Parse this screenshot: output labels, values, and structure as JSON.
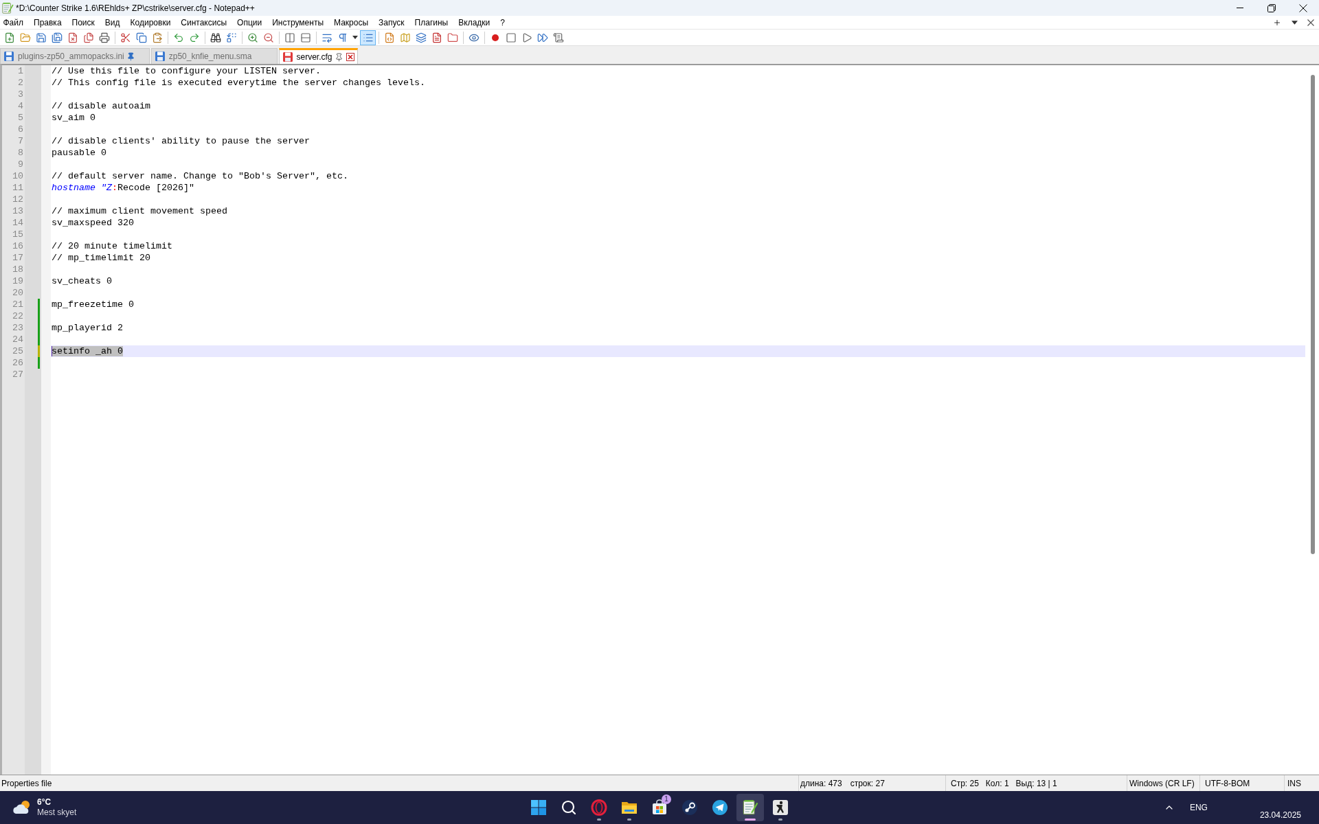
{
  "window": {
    "title": "*D:\\Counter Strike 1.6\\REhlds+ ZP\\cstrike\\server.cfg - Notepad++"
  },
  "menu": [
    "Файл",
    "Правка",
    "Поиск",
    "Вид",
    "Кодировки",
    "Синтаксисы",
    "Опции",
    "Инструменты",
    "Макросы",
    "Запуск",
    "Плагины",
    "Вкладки",
    "?"
  ],
  "toolbar": {
    "buttons": [
      {
        "on": false
      },
      {
        "on": false
      },
      {
        "on": false
      },
      {
        "on": false
      },
      {
        "on": false
      },
      {
        "on": false
      },
      {
        "on": false
      },
      {
        "on": false
      },
      {
        "on": false
      },
      {
        "on": false
      },
      {
        "on": false
      },
      {
        "on": false
      },
      {
        "on": false
      },
      {
        "on": false
      },
      {
        "on": false
      },
      {
        "on": false
      },
      {
        "on": false
      },
      {
        "on": false
      },
      {
        "on": false
      },
      {
        "on": false
      },
      {
        "on": false
      },
      {
        "on": true
      },
      {
        "on": false
      },
      {
        "on": false
      },
      {
        "on": false
      },
      {
        "on": false
      },
      {
        "on": false
      },
      {
        "on": false
      },
      {
        "on": false
      },
      {
        "on": false
      },
      {
        "on": false
      },
      {
        "on": false
      },
      {
        "on": false
      }
    ]
  },
  "tabs": [
    {
      "label": "plugins-zp50_ammopacks.ini",
      "selected": false,
      "modified": false,
      "pinned": true
    },
    {
      "label": "zp50_knfie_menu.sma",
      "selected": false,
      "modified": false,
      "pinned": false
    },
    {
      "label": "server.cfg",
      "selected": true,
      "modified": true,
      "pinned": false
    }
  ],
  "editor": {
    "lines": [
      {
        "number": "1",
        "tokens": [
          {
            "text": "// Use this file to configure your LISTEN server.",
            "kind": "default"
          }
        ],
        "modified": false,
        "current": false
      },
      {
        "number": "2",
        "tokens": [
          {
            "text": "// This config file is executed everytime the server changes levels.",
            "kind": "default"
          }
        ],
        "modified": false,
        "current": false
      },
      {
        "number": "3",
        "modified": false,
        "current": false
      },
      {
        "number": "4",
        "tokens": [
          {
            "text": "// disable autoaim",
            "kind": "default"
          }
        ],
        "modified": false,
        "current": false
      },
      {
        "number": "5",
        "tokens": [
          {
            "text": "sv_aim 0",
            "kind": "default"
          }
        ],
        "modified": false,
        "current": false
      },
      {
        "number": "6",
        "modified": false,
        "current": false
      },
      {
        "number": "7",
        "tokens": [
          {
            "text": "// disable clients' ability to pause the server",
            "kind": "default"
          }
        ],
        "modified": false,
        "current": false
      },
      {
        "number": "8",
        "tokens": [
          {
            "text": "pausable 0",
            "kind": "default"
          }
        ],
        "modified": false,
        "current": false
      },
      {
        "number": "9",
        "modified": false,
        "current": false
      },
      {
        "number": "10",
        "tokens": [
          {
            "text": "// default server name. Change to \"Bob's Server\", etc.",
            "kind": "default"
          }
        ],
        "modified": false,
        "current": false
      },
      {
        "number": "11",
        "tokens": [
          {
            "text": "hostname \"Z",
            "kind": "key"
          },
          {
            "text": ":",
            "kind": "separator"
          },
          {
            "text": "Recode [2026]\"",
            "kind": "default"
          }
        ],
        "modified": false,
        "current": false
      },
      {
        "number": "12",
        "modified": false,
        "current": false
      },
      {
        "number": "13",
        "tokens": [
          {
            "text": "// maximum client movement speed",
            "kind": "default"
          }
        ],
        "modified": false,
        "current": false
      },
      {
        "number": "14",
        "tokens": [
          {
            "text": "sv_maxspeed 320",
            "kind": "default"
          }
        ],
        "modified": false,
        "current": false
      },
      {
        "number": "15",
        "modified": false,
        "current": false
      },
      {
        "number": "16",
        "tokens": [
          {
            "text": "// 20 minute timelimit",
            "kind": "default"
          }
        ],
        "modified": false,
        "current": false
      },
      {
        "number": "17",
        "tokens": [
          {
            "text": "// mp_timelimit 20",
            "kind": "default"
          }
        ],
        "modified": false,
        "current": false
      },
      {
        "number": "18",
        "modified": false,
        "current": false
      },
      {
        "number": "19",
        "tokens": [
          {
            "text": "sv_cheats 0",
            "kind": "default"
          }
        ],
        "modified": false,
        "current": false
      },
      {
        "number": "20",
        "modified": false,
        "current": false
      },
      {
        "number": "21",
        "tokens": [
          {
            "text": "mp_freezetime 0",
            "kind": "default"
          }
        ],
        "modified": true,
        "saved": true,
        "current": false
      },
      {
        "number": "22",
        "modified": true,
        "saved": true,
        "current": false
      },
      {
        "number": "23",
        "tokens": [
          {
            "text": "mp_playerid 2",
            "kind": "default"
          }
        ],
        "modified": true,
        "saved": true,
        "current": false
      },
      {
        "number": "24",
        "modified": true,
        "saved": true,
        "current": false
      },
      {
        "number": "25",
        "tokens": [
          {
            "text": "setinfo _ah 0",
            "kind": "default"
          }
        ],
        "modified": true,
        "saved": false,
        "current": true,
        "selected": true
      },
      {
        "number": "26",
        "modified": true,
        "saved": true,
        "current": false
      },
      {
        "number": "27",
        "modified": false,
        "current": false
      }
    ]
  },
  "status_bar": {
    "file_type": "Properties file",
    "length": "длина: 473",
    "line_count": "строк: 27",
    "line": "Стр: 25",
    "column": "Кол: 1",
    "selection": "Выд: 13 | 1",
    "eol": "Windows (CR LF)",
    "encoding": "UTF-8-BOM",
    "mode": "INS"
  },
  "taskbar": {
    "weather": {
      "temperature": "6°C",
      "condition": "Mest skyet"
    },
    "apps": [
      {
        "running": false,
        "active": false
      },
      {
        "running": false,
        "active": false
      },
      {
        "running": true,
        "active": false
      },
      {
        "running": true,
        "active": false
      },
      {
        "running": false,
        "active": false,
        "badge": "1"
      },
      {
        "running": false,
        "active": false
      },
      {
        "running": false,
        "active": false
      },
      {
        "running": true,
        "active": true
      },
      {
        "running": true,
        "active": false
      }
    ],
    "tray": {
      "language": "ENG",
      "date": "23.04.2025"
    }
  }
}
